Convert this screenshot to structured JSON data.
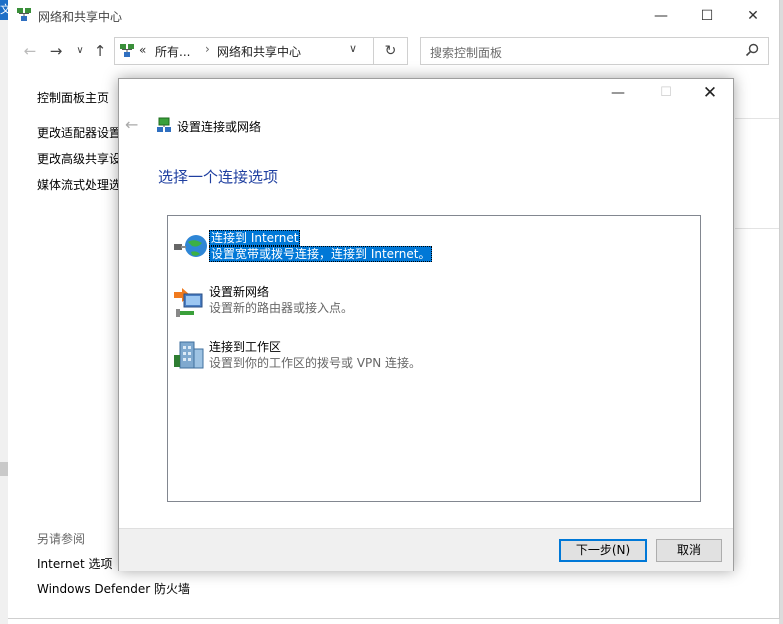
{
  "explorer": {
    "left_edge_text": "文",
    "title": "网络和共享中心",
    "address": {
      "crumb_root": "所有...",
      "crumb_current": "网络和共享中心",
      "chevron": "«",
      "separator": "›"
    },
    "search_placeholder": "搜索控制面板",
    "sidebar": {
      "home": "控制面板主页",
      "adapter": "更改适配器设置",
      "sharing": "更改高级共享设",
      "media": "媒体流式处理选"
    },
    "see_also": {
      "heading": "另请参阅",
      "internet_options": "Internet 选项",
      "firewall": "Windows Defender 防火墙"
    }
  },
  "dialog": {
    "title": "设置连接或网络",
    "heading": "选择一个连接选项",
    "options": [
      {
        "title": "连接到 Internet",
        "desc": "设置宽带或拨号连接，连接到 Internet。",
        "icon": "globe-network-icon",
        "selected": true
      },
      {
        "title": "设置新网络",
        "desc": "设置新的路由器或接入点。",
        "icon": "new-network-router-icon",
        "selected": false
      },
      {
        "title": "连接到工作区",
        "desc": "设置到你的工作区的拨号或 VPN 连接。",
        "icon": "workplace-building-icon",
        "selected": false
      }
    ],
    "buttons": {
      "next": "下一步(N)",
      "cancel": "取消"
    }
  },
  "colors": {
    "accent": "#0078d7",
    "heading": "#1f3fa0",
    "footer_bg": "#f0f0f0"
  }
}
